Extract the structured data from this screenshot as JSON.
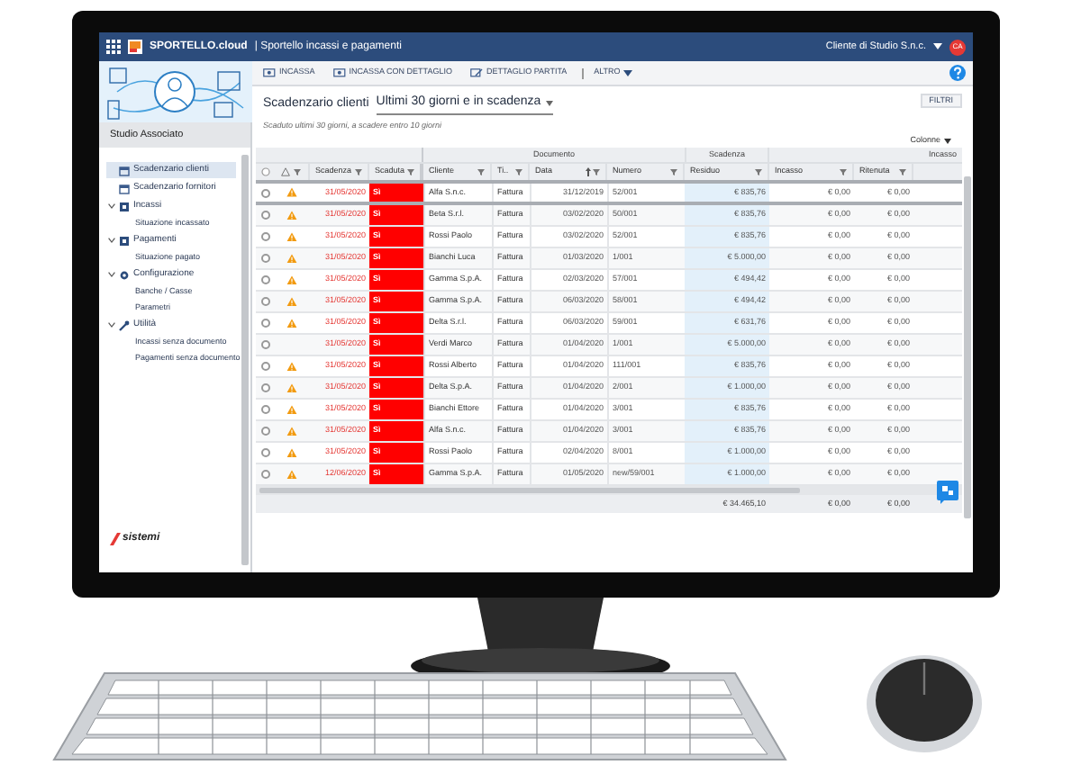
{
  "app_bar": {
    "brand": "SPORTELLO.cloud",
    "title": "| Sportello incassi e pagamenti",
    "user": "Cliente di Studio S.n.c.",
    "avatar": "CA"
  },
  "sidebar": {
    "studio": "Studio Associato",
    "logo": "sistemi",
    "items": [
      {
        "label": "Scadenzario clienti",
        "kind": "schedule",
        "selected": true,
        "expanded": false
      },
      {
        "label": "Scadenzario fornitori",
        "kind": "schedule",
        "selected": false,
        "expanded": false
      },
      {
        "label": "Incassi",
        "kind": "cash",
        "selected": false,
        "expanded": true,
        "children": [
          {
            "label": "Situazione incassato",
            "selected": false
          }
        ]
      },
      {
        "label": "Pagamenti",
        "kind": "cash",
        "selected": false,
        "expanded": true,
        "children": [
          {
            "label": "Situazione pagato",
            "selected": false
          }
        ]
      },
      {
        "label": "Configurazione",
        "kind": "settings",
        "selected": false,
        "expanded": true,
        "children": [
          {
            "label": "Banche / Casse",
            "selected": false
          },
          {
            "label": "Parametri",
            "selected": false
          }
        ]
      },
      {
        "label": "Utilità",
        "kind": "tools",
        "selected": false,
        "expanded": true,
        "children": [
          {
            "label": "Incassi senza documento",
            "selected": false
          },
          {
            "label": "Pagamenti senza documento",
            "selected": false
          }
        ]
      }
    ]
  },
  "toolbar": {
    "buttons": [
      {
        "label": "INCASSA",
        "kind": "cash"
      },
      {
        "label": "INCASSA CON DETTAGLIO",
        "kind": "cash"
      },
      {
        "label": "DETTAGLIO PARTITA",
        "kind": "edit"
      }
    ],
    "more": "ALTRO"
  },
  "page": {
    "title": "Scadenzario clienti",
    "view": "Ultimi 30 giorni e in scadenza",
    "subtitle": "Scaduto ultimi 30 giorni, a scadere entro 10 giorni",
    "filters": "FILTRI",
    "columns": "Colonne"
  },
  "table": {
    "groups": [
      "Documento",
      "Scadenza",
      "Incasso"
    ],
    "columns": [
      {
        "label": "Scadenza",
        "sorted": false
      },
      {
        "label": "Scaduta",
        "sorted": false
      },
      {
        "label": "Cliente",
        "sorted": false
      },
      {
        "label": "Ti..",
        "sorted": false
      },
      {
        "label": "Data",
        "sorted": true
      },
      {
        "label": "Numero",
        "sorted": false
      },
      {
        "label": "Residuo",
        "sorted": false
      },
      {
        "label": "Incasso",
        "sorted": false
      },
      {
        "label": "Ritenuta",
        "sorted": false
      }
    ],
    "rows": [
      {
        "checked": false,
        "warning": true,
        "due": "31/05/2020",
        "overdue": true,
        "overdue_label": "Sì",
        "client": "Alfa S.n.c.",
        "type": "Fattura",
        "date": "31/12/2019",
        "number": "52/001",
        "residual": "€ 835,76",
        "collected": "€ 0,00",
        "withholding": "€ 0,00"
      },
      {
        "checked": false,
        "warning": true,
        "due": "31/05/2020",
        "overdue": true,
        "overdue_label": "Sì",
        "client": "Beta S.r.l.",
        "type": "Fattura",
        "date": "03/02/2020",
        "number": "50/001",
        "residual": "€ 835,76",
        "collected": "€ 0,00",
        "withholding": "€ 0,00"
      },
      {
        "checked": false,
        "warning": true,
        "due": "31/05/2020",
        "overdue": true,
        "overdue_label": "Sì",
        "client": "Rossi Paolo",
        "type": "Fattura",
        "date": "03/02/2020",
        "number": "52/001",
        "residual": "€ 835,76",
        "collected": "€ 0,00",
        "withholding": "€ 0,00"
      },
      {
        "checked": false,
        "warning": true,
        "due": "31/05/2020",
        "overdue": true,
        "overdue_label": "Sì",
        "client": "Bianchi Luca",
        "type": "Fattura",
        "date": "01/03/2020",
        "number": "1/001",
        "residual": "€ 5.000,00",
        "collected": "€ 0,00",
        "withholding": "€ 0,00"
      },
      {
        "checked": false,
        "warning": true,
        "due": "31/05/2020",
        "overdue": true,
        "overdue_label": "Sì",
        "client": "Gamma S.p.A.",
        "type": "Fattura",
        "date": "02/03/2020",
        "number": "57/001",
        "residual": "€ 494,42",
        "collected": "€ 0,00",
        "withholding": "€ 0,00"
      },
      {
        "checked": false,
        "warning": true,
        "due": "31/05/2020",
        "overdue": true,
        "overdue_label": "Sì",
        "client": "Gamma S.p.A.",
        "type": "Fattura",
        "date": "06/03/2020",
        "number": "58/001",
        "residual": "€ 494,42",
        "collected": "€ 0,00",
        "withholding": "€ 0,00"
      },
      {
        "checked": false,
        "warning": true,
        "due": "31/05/2020",
        "overdue": true,
        "overdue_label": "Sì",
        "client": "Delta S.r.l.",
        "type": "Fattura",
        "date": "06/03/2020",
        "number": "59/001",
        "residual": "€ 631,76",
        "collected": "€ 0,00",
        "withholding": "€ 0,00"
      },
      {
        "checked": false,
        "warning": false,
        "due": "31/05/2020",
        "overdue": true,
        "overdue_label": "Sì",
        "client": "Verdi Marco",
        "type": "Fattura",
        "date": "01/04/2020",
        "number": "1/001",
        "residual": "€ 5.000,00",
        "collected": "€ 0,00",
        "withholding": "€ 0,00"
      },
      {
        "checked": false,
        "warning": true,
        "due": "31/05/2020",
        "overdue": true,
        "overdue_label": "Sì",
        "client": "Rossi Alberto",
        "type": "Fattura",
        "date": "01/04/2020",
        "number": "111/001",
        "residual": "€ 835,76",
        "collected": "€ 0,00",
        "withholding": "€ 0,00"
      },
      {
        "checked": false,
        "warning": true,
        "due": "31/05/2020",
        "overdue": true,
        "overdue_label": "Sì",
        "client": "Delta S.p.A.",
        "type": "Fattura",
        "date": "01/04/2020",
        "number": "2/001",
        "residual": "€ 1.000,00",
        "collected": "€ 0,00",
        "withholding": "€ 0,00"
      },
      {
        "checked": false,
        "warning": true,
        "due": "31/05/2020",
        "overdue": true,
        "overdue_label": "Sì",
        "client": "Bianchi Ettore",
        "type": "Fattura",
        "date": "01/04/2020",
        "number": "3/001",
        "residual": "€ 835,76",
        "collected": "€ 0,00",
        "withholding": "€ 0,00"
      },
      {
        "checked": false,
        "warning": true,
        "due": "31/05/2020",
        "overdue": true,
        "overdue_label": "Sì",
        "client": "Alfa S.n.c.",
        "type": "Fattura",
        "date": "01/04/2020",
        "number": "3/001",
        "residual": "€ 835,76",
        "collected": "€ 0,00",
        "withholding": "€ 0,00"
      },
      {
        "checked": false,
        "warning": true,
        "due": "31/05/2020",
        "overdue": true,
        "overdue_label": "Sì",
        "client": "Rossi Paolo",
        "type": "Fattura",
        "date": "02/04/2020",
        "number": "8/001",
        "residual": "€ 1.000,00",
        "collected": "€ 0,00",
        "withholding": "€ 0,00"
      },
      {
        "checked": false,
        "warning": true,
        "due": "12/06/2020",
        "overdue": true,
        "overdue_label": "Sì",
        "client": "Gamma S.p.A.",
        "type": "Fattura",
        "date": "01/05/2020",
        "number": "new/59/001",
        "residual": "€ 1.000,00",
        "collected": "€ 0,00",
        "withholding": "€ 0,00"
      }
    ],
    "totals": {
      "residual": "€ 34.465,10",
      "collected": "€ 0,00",
      "withholding": "€ 0,00"
    }
  }
}
